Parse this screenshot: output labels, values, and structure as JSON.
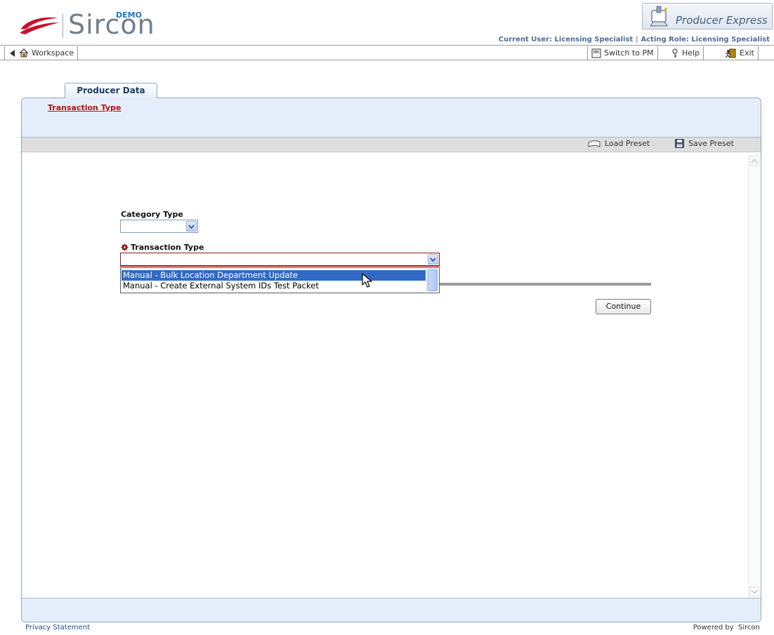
{
  "header": {
    "logo_text": "Sircon",
    "logo_badge": "DEMO",
    "product_name": "Producer Express",
    "current_user_label": "Current User: Licensing Specialist",
    "acting_role_label": "Acting Role: Licensing Specialist",
    "separator": "|"
  },
  "toolbar": {
    "workspace_label": "Workspace",
    "switch_label": "Switch to PM",
    "help_label": "Help",
    "exit_label": "Exit"
  },
  "tabs": [
    {
      "label": "Producer Data",
      "active": true
    }
  ],
  "breadcrumb": {
    "current": "Transaction Type"
  },
  "presets": {
    "load_label": "Load Preset",
    "save_label": "Save Preset"
  },
  "form": {
    "category_type": {
      "label": "Category Type",
      "value": ""
    },
    "transaction_type": {
      "label": "Transaction Type",
      "required": true,
      "value": "",
      "options": [
        {
          "label": "Manual - Bulk Location Department Update",
          "highlighted": true
        },
        {
          "label": "Manual - Create External System IDs Test Packet",
          "highlighted": false
        }
      ]
    },
    "continue_label": "Continue"
  },
  "footer": {
    "privacy_label": "Privacy Statement",
    "powered_by": "Powered by  Sircon"
  },
  "colors": {
    "accent_blue": "#316ac5",
    "breadcrumb_red": "#b01010",
    "panel_bg": "#e4eefa",
    "tab_text": "#1e3d66"
  }
}
